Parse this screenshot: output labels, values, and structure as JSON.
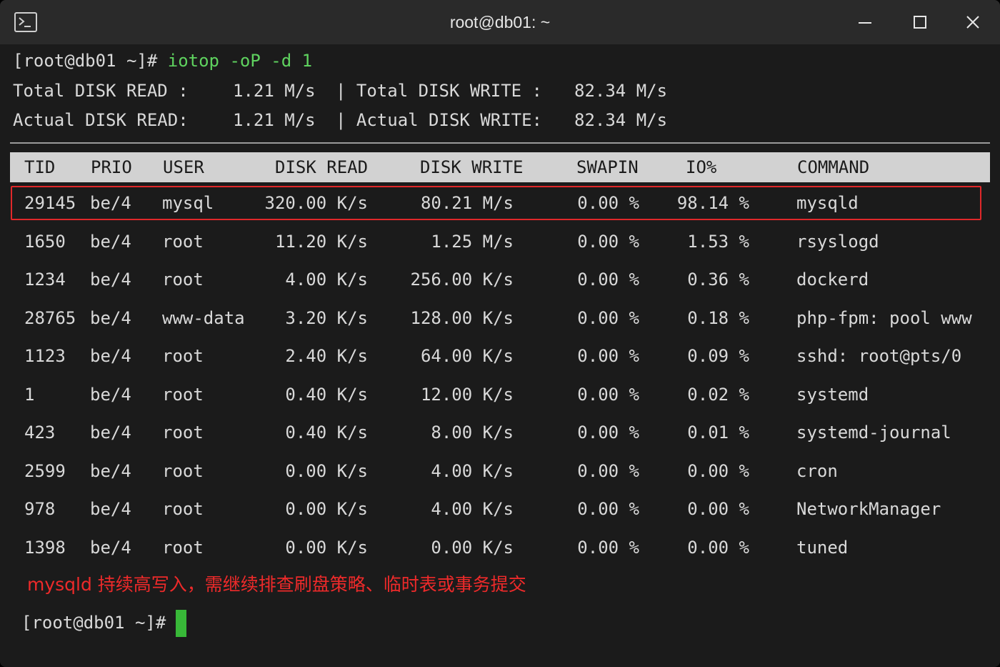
{
  "window": {
    "title": "root@db01: ~"
  },
  "command_line": {
    "prompt": "[root@db01 ~]# ",
    "command": "iotop -oP -d 1"
  },
  "summary": {
    "total_read_label": "Total DISK READ :",
    "total_read_value": "1.21 M/s",
    "total_write_label": "| Total DISK WRITE :",
    "total_write_value": "82.34 M/s",
    "actual_read_label": "Actual DISK READ:",
    "actual_read_value": "1.21 M/s",
    "actual_write_label": "| Actual DISK WRITE:",
    "actual_write_value": "82.34 M/s"
  },
  "table": {
    "headers": [
      "TID",
      "PRIO",
      "USER",
      "DISK READ",
      "DISK WRITE",
      "SWAPIN",
      "IO%",
      "COMMAND"
    ],
    "rows": [
      {
        "tid": "29145",
        "prio": "be/4",
        "user": "mysql",
        "read": "320.00 K/s",
        "write": "80.21 M/s",
        "swapin": "0.00 %",
        "io": "98.14 %",
        "command": "mysqld"
      },
      {
        "tid": "1650",
        "prio": "be/4",
        "user": "root",
        "read": "11.20 K/s",
        "write": "1.25 M/s",
        "swapin": "0.00 %",
        "io": "1.53 %",
        "command": "rsyslogd"
      },
      {
        "tid": "1234",
        "prio": "be/4",
        "user": "root",
        "read": "4.00 K/s",
        "write": "256.00 K/s",
        "swapin": "0.00 %",
        "io": "0.36 %",
        "command": "dockerd"
      },
      {
        "tid": "28765",
        "prio": "be/4",
        "user": "www-data",
        "read": "3.20 K/s",
        "write": "128.00 K/s",
        "swapin": "0.00 %",
        "io": "0.18 %",
        "command": "php-fpm: pool www"
      },
      {
        "tid": "1123",
        "prio": "be/4",
        "user": "root",
        "read": "2.40 K/s",
        "write": "64.00 K/s",
        "swapin": "0.00 %",
        "io": "0.09 %",
        "command": "sshd: root@pts/0"
      },
      {
        "tid": "1",
        "prio": "be/4",
        "user": "root",
        "read": "0.40 K/s",
        "write": "12.00 K/s",
        "swapin": "0.00 %",
        "io": "0.02 %",
        "command": "systemd"
      },
      {
        "tid": "423",
        "prio": "be/4",
        "user": "root",
        "read": "0.40 K/s",
        "write": "8.00 K/s",
        "swapin": "0.00 %",
        "io": "0.01 %",
        "command": "systemd-journal"
      },
      {
        "tid": "2599",
        "prio": "be/4",
        "user": "root",
        "read": "0.00 K/s",
        "write": "4.00 K/s",
        "swapin": "0.00 %",
        "io": "0.00 %",
        "command": "cron"
      },
      {
        "tid": "978",
        "prio": "be/4",
        "user": "root",
        "read": "0.00 K/s",
        "write": "4.00 K/s",
        "swapin": "0.00 %",
        "io": "0.00 %",
        "command": "NetworkManager"
      },
      {
        "tid": "1398",
        "prio": "be/4",
        "user": "root",
        "read": "0.00 K/s",
        "write": "0.00 K/s",
        "swapin": "0.00 %",
        "io": "0.00 %",
        "command": "tuned"
      }
    ]
  },
  "annotation": {
    "text": "mysqld 持续高写入，需继续排查刷盘策略、临时表或事务提交",
    "color": "#ee2a2a"
  },
  "final_prompt": "[root@db01 ~]#",
  "colors": {
    "background": "#1b1b1b",
    "command": "#5fd35f",
    "cursor": "#38b838",
    "highlight_border": "#e0282a",
    "header_bg": "#d2d2d2"
  },
  "icons": {
    "app": "terminal-icon",
    "minimize": "minimize-icon",
    "maximize": "maximize-icon",
    "close": "close-icon"
  }
}
